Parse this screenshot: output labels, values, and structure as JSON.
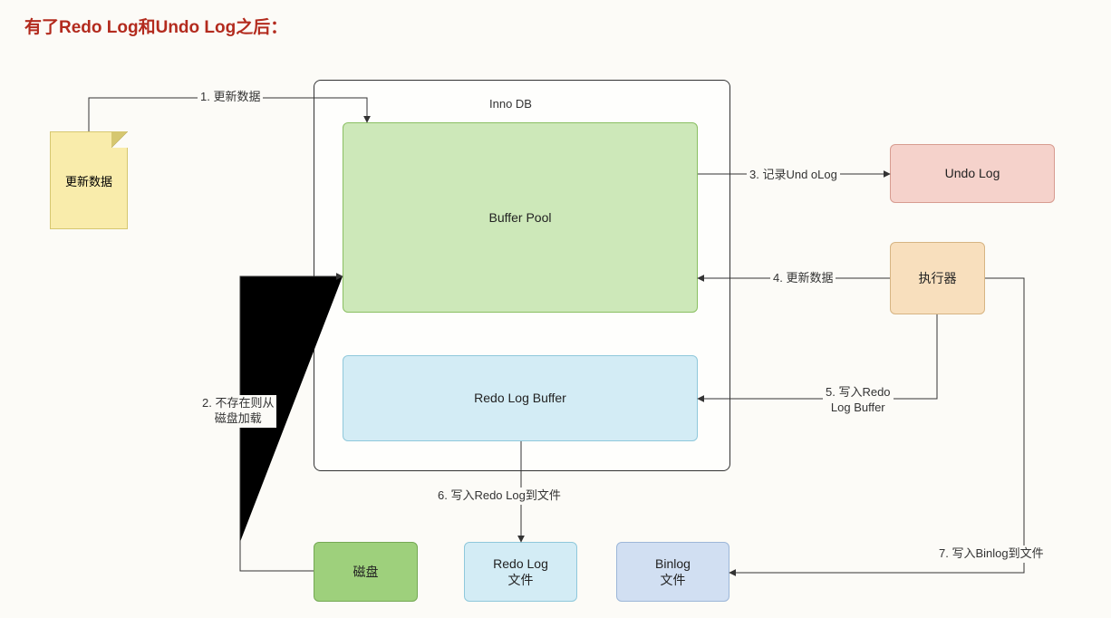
{
  "title": "有了Redo Log和Undo Log之后：",
  "nodes": {
    "innodb": "Inno DB",
    "buffer_pool": "Buffer Pool",
    "redo_log_buffer": "Redo Log Buffer",
    "update_note": "更新数据",
    "undo_log": "Undo Log",
    "executor": "执行器",
    "disk": "磁盘",
    "redolog_file": "Redo Log\n文件",
    "binlog_file": "Binlog\n文件"
  },
  "edges": {
    "e1": "1. 更新数据",
    "e2": "2. 不存在则从\n磁盘加载",
    "e3": "3. 记录Und oLog",
    "e4": "4. 更新数据",
    "e5": "5. 写入Redo\nLog Buffer",
    "e6": "6. 写入Redo Log到文件",
    "e7": "7. 写入Binlog到文件"
  }
}
